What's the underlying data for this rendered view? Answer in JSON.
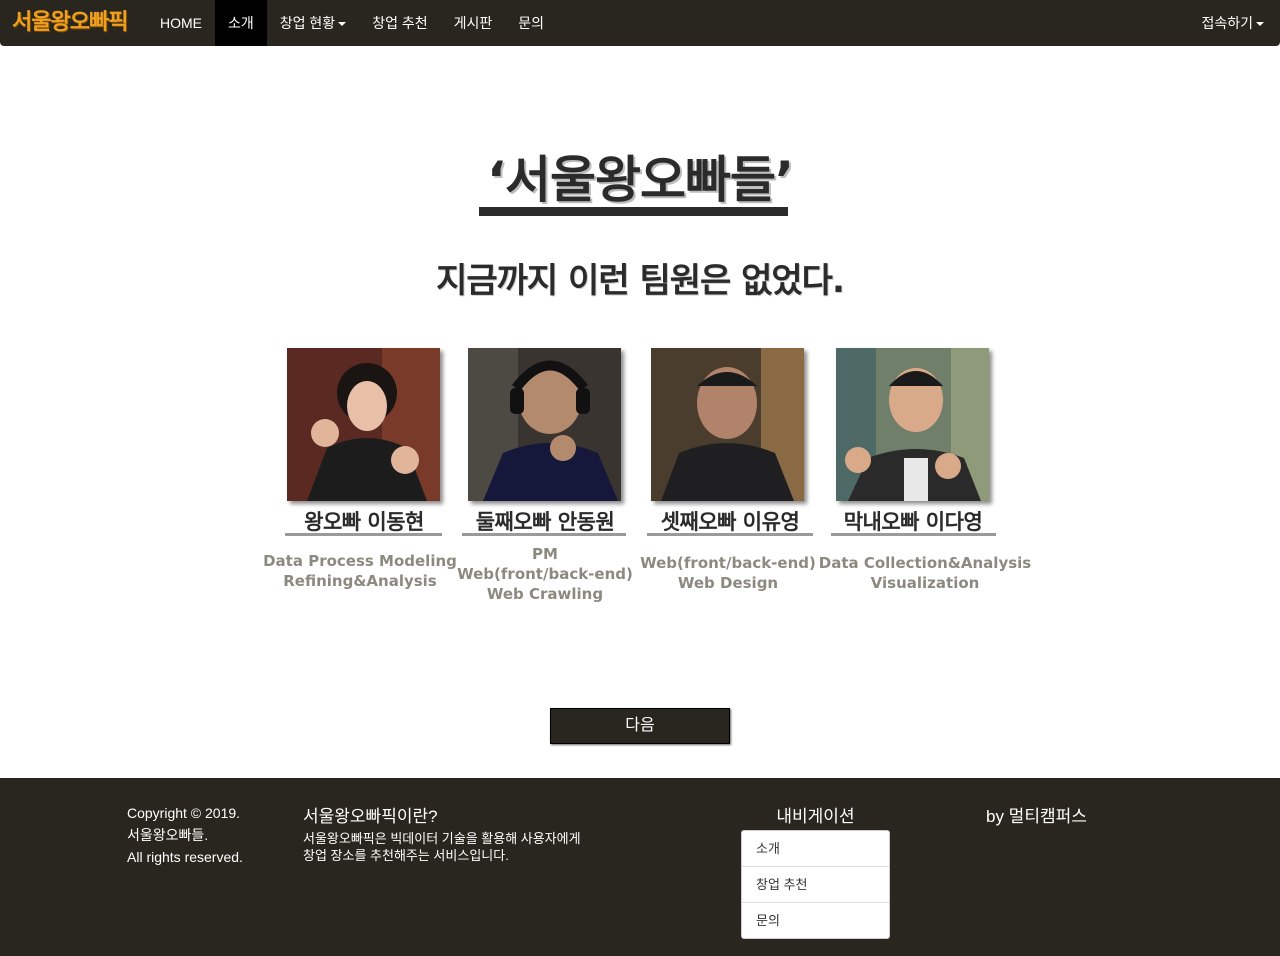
{
  "brand": {
    "logo_text": "서울왕오빠픽",
    "color": "#f0a020"
  },
  "nav": {
    "items": [
      {
        "label": "HOME"
      },
      {
        "label": "소개",
        "active": true
      },
      {
        "label": "창업 현황",
        "dropdown": true
      },
      {
        "label": "창업 추천"
      },
      {
        "label": "게시판"
      },
      {
        "label": "문의"
      }
    ],
    "right_label": "접속하기"
  },
  "hero": {
    "title": "‘서울왕오빠들’",
    "subtitle": "지금까지 이런 팀원은 없었다."
  },
  "members": [
    {
      "name": "왕오빠 이동현",
      "roles": [
        "Data Process Modeling",
        "Refining&Analysis"
      ]
    },
    {
      "name": "둘째오빠 안동원",
      "roles": [
        "PM",
        "Web(front/back-end)",
        "Web Crawling"
      ]
    },
    {
      "name": "셋째오빠 이유영",
      "roles": [
        "Web(front/back-end)",
        "Web Design"
      ]
    },
    {
      "name": "막내오빠 이다영",
      "roles": [
        "Data Collection&Analysis",
        "Visualization"
      ]
    }
  ],
  "next_button": {
    "label": "다음"
  },
  "footer": {
    "copyright_lines": [
      "Copyright © 2019.",
      "서울왕오빠들.",
      "All rights reserved."
    ],
    "about_title": "서울왕오빠픽이란?",
    "about_lines": [
      "서울왕오빠픽은 빅데이터 기술을 활용해 사용자에게",
      "창업 장소를 추천해주는 서비스입니다."
    ],
    "navigation_title": "내비게이션",
    "navigation_items": [
      "소개",
      "창업 추천",
      "문의"
    ],
    "by_text": "by 멀티캠퍼스"
  },
  "colors": {
    "nav_bg": "#29261f",
    "active_bg": "#000000",
    "role_text": "#8c8a80",
    "dark_text": "#2b2b2b"
  }
}
